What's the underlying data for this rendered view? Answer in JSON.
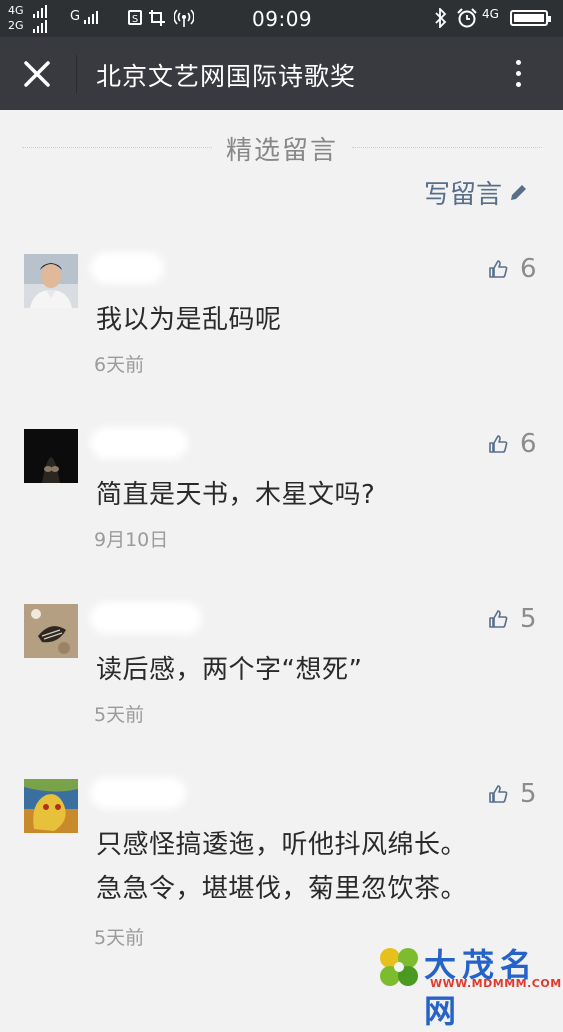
{
  "status_bar": {
    "network_top": "4G",
    "network_bottom": "2G",
    "carrier_type": "G",
    "sim_label": "S",
    "time": "09:09",
    "network_right": "4G"
  },
  "header": {
    "title": "北京文艺网国际诗歌奖"
  },
  "section": {
    "title": "精选留言",
    "write_label": "写留言"
  },
  "comments": [
    {
      "likes": "6",
      "content": "我以为是乱码呢",
      "date": "6天前"
    },
    {
      "likes": "6",
      "content": "简直是天书，木星文吗?",
      "date": "9月10日"
    },
    {
      "likes": "5",
      "content": "读后感，两个字“想死”",
      "date": "5天前"
    },
    {
      "likes": "5",
      "content": "只感怪搞逶迤，听他抖风绵长。\n急急令，堪堪伐，菊里忽饮茶。",
      "date": "5天前"
    }
  ],
  "watermark": {
    "name": "大茂名网",
    "url": "WWW.MDMMM.COM"
  },
  "colors": {
    "status_bar": "#2e3134",
    "title_bar": "#393a3f",
    "background": "#f2f2f2",
    "link": "#586f8c"
  }
}
